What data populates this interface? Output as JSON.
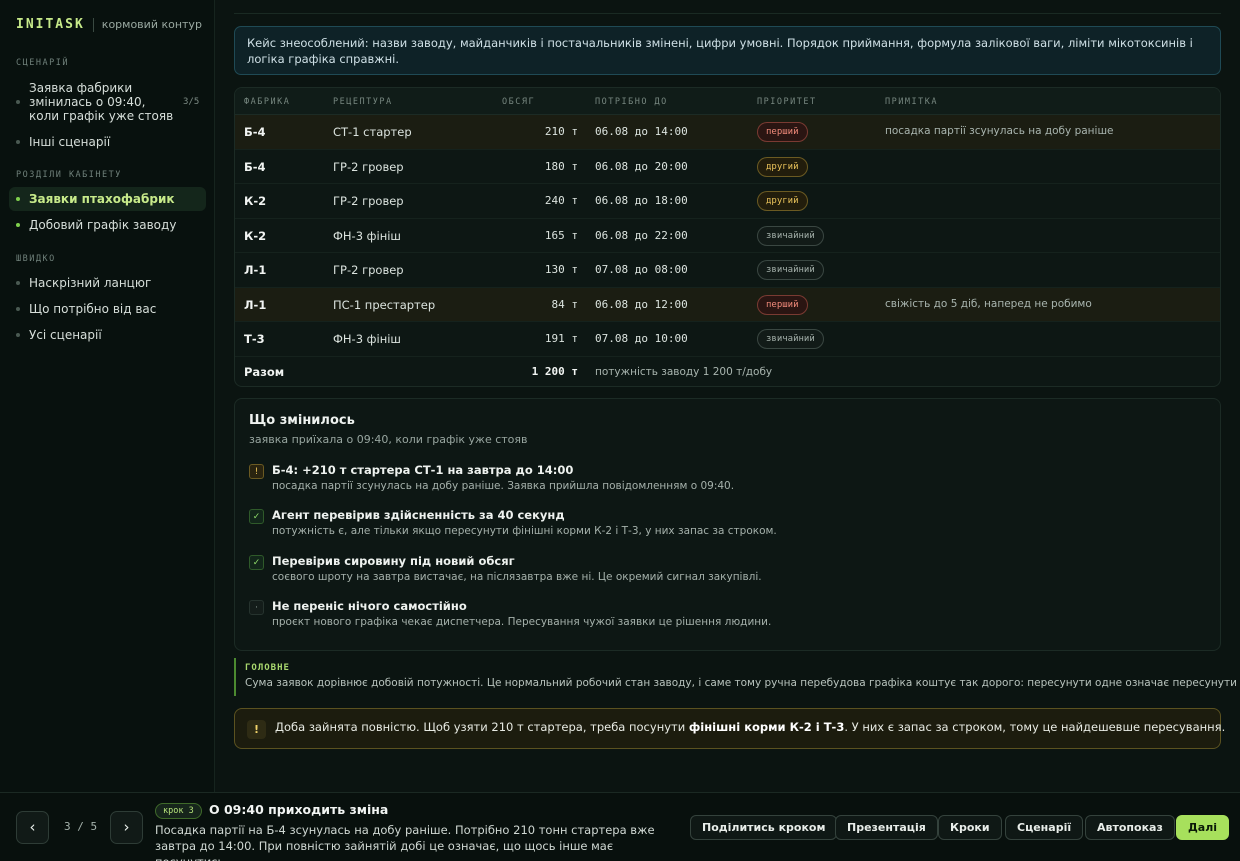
{
  "brand": {
    "name": "INITASK",
    "subtitle": "кормовий контур"
  },
  "sidebar": {
    "sections": [
      {
        "label": "СЦЕНАРІЙ"
      },
      {
        "label": "РОЗДІЛИ КАБІНЕТУ"
      },
      {
        "label": "ШВИДКО"
      }
    ],
    "scenario": {
      "title": "Заявка фабрики змінилась о 09:40, коли графік уже стояв",
      "count": "3/5",
      "other": "Інші сценарії"
    },
    "cabinet": [
      "Заявки птахофабрик",
      "Добовий графік заводу"
    ],
    "quick": [
      "Наскрізний ланцюг",
      "Що потрібно від вас",
      "Усі сценарії"
    ]
  },
  "notice": "Кейс знеособлений: назви заводу, майданчиків і постачальників змінені, цифри умовні. Порядок приймання, формула залікової ваги, ліміти мікотоксинів і логіка графіка справжні.",
  "table": {
    "headers": [
      "ФАБРИКА",
      "РЕЦЕПТУРА",
      "ОБСЯГ",
      "ПОТРІБНО ДО",
      "ПРІОРИТЕТ",
      "ПРИМІТКА"
    ],
    "rows": [
      {
        "fab": "Б-4",
        "recipe": "СТ-1 стартер",
        "volume": "210 т",
        "due": "06.08 до 14:00",
        "priority": "перший",
        "ptype": "first",
        "note": "посадка партії зсунулась на добу раніше",
        "hl": true
      },
      {
        "fab": "Б-4",
        "recipe": "ГР-2 гровер",
        "volume": "180 т",
        "due": "06.08 до 20:00",
        "priority": "другий",
        "ptype": "second",
        "note": "",
        "hl": false
      },
      {
        "fab": "К-2",
        "recipe": "ГР-2 гровер",
        "volume": "240 т",
        "due": "06.08 до 18:00",
        "priority": "другий",
        "ptype": "second",
        "note": "",
        "hl": false
      },
      {
        "fab": "К-2",
        "recipe": "ФН-3 фініш",
        "volume": "165 т",
        "due": "06.08 до 22:00",
        "priority": "звичайний",
        "ptype": "normal",
        "note": "",
        "hl": false
      },
      {
        "fab": "Л-1",
        "recipe": "ГР-2 гровер",
        "volume": "130 т",
        "due": "07.08 до 08:00",
        "priority": "звичайний",
        "ptype": "normal",
        "note": "",
        "hl": false
      },
      {
        "fab": "Л-1",
        "recipe": "ПС-1 престартер",
        "volume": "84 т",
        "due": "06.08 до 12:00",
        "priority": "перший",
        "ptype": "first",
        "note": "свіжість до 5 діб, наперед не робимо",
        "hl": true
      },
      {
        "fab": "Т-3",
        "recipe": "ФН-3 фініш",
        "volume": "191 т",
        "due": "07.08 до 10:00",
        "priority": "звичайний",
        "ptype": "normal",
        "note": "",
        "hl": false
      }
    ],
    "total": {
      "label": "Разом",
      "volume": "1 200 т",
      "note": "потужність заводу 1 200 т/добу"
    }
  },
  "changes": {
    "title": "Що змінилось",
    "subtitle": "заявка приїхала о 09:40, коли графік уже стояв",
    "events": [
      {
        "icon": "!",
        "kind": "warn",
        "title": "Б-4: +210 т стартера СТ-1 на завтра до 14:00",
        "desc": "посадка партії зсунулась на добу раніше. Заявка прийшла повідомленням о 09:40."
      },
      {
        "icon": "✓",
        "kind": "ok",
        "title": "Агент перевірив здійсненність за 40 секунд",
        "desc": "потужність є, але тільки якщо пересунути фінішні корми К-2 і Т-3, у них запас за строком."
      },
      {
        "icon": "✓",
        "kind": "ok",
        "title": "Перевірив сировину під новий обсяг",
        "desc": "соєвого шроту на завтра вистачає, на післязавтра вже ні. Це окремий сигнал закупівлі."
      },
      {
        "icon": "·",
        "kind": "dot",
        "title": "Не переніс нічого самостійно",
        "desc": "проєкт нового графіка чекає диспетчера. Пересування чужої заявки це рішення людини."
      }
    ]
  },
  "main_note": {
    "label": "ГОЛОВНЕ",
    "text": "Сума заявок дорівнює добовій потужності. Це нормальний робочий стан заводу, і саме тому ручна перебудова графіка коштує так дорого: пересунути одне означає пересунути все."
  },
  "callout": {
    "icon": "!",
    "before": "Доба зайнята повністю. Щоб узяти 210 т стартера, треба посунути ",
    "bold": "фінішні корми К-2 і Т-3",
    "after": ". У них є запас за строком, тому це найдешевше пересування."
  },
  "bottom": {
    "prev": "‹",
    "next": "›",
    "pager": "3 / 5",
    "step_badge": "крок 3",
    "step_title": "О 09:40 приходить зміна",
    "step_desc": "Посадка партії на Б-4 зсунулась на добу раніше. Потрібно 210 тонн стартера вже завтра до 14:00. При повністю зайнятій добі це означає, що щось інше має посунутись.",
    "actions": [
      "Поділитись кроком",
      "Презентація",
      "Кроки",
      "Сценарії",
      "Автопоказ",
      "Далі"
    ]
  },
  "colors": {
    "accent": "#a7e05c",
    "first": "#f08a7a",
    "second": "#e9c25a",
    "notice_border": "#1f4a55"
  }
}
